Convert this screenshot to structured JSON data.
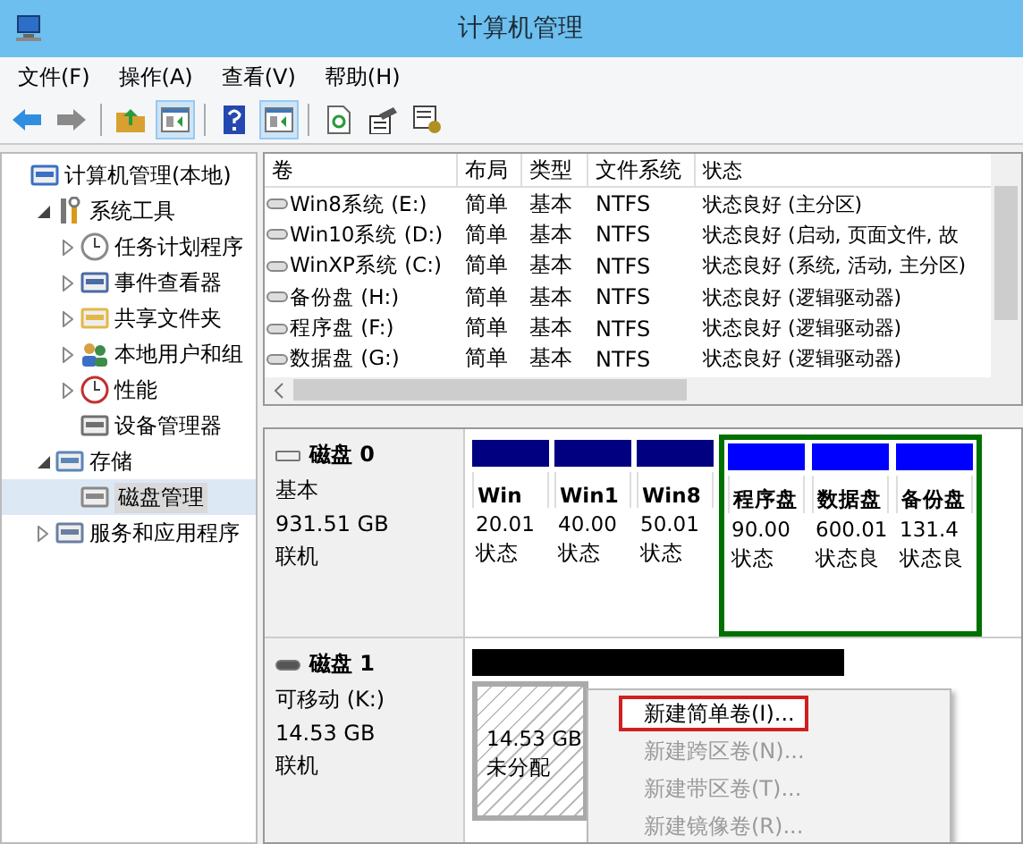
{
  "window": {
    "title": "计算机管理"
  },
  "menu": [
    "文件(F)",
    "操作(A)",
    "查看(V)",
    "帮助(H)"
  ],
  "toolbar": [
    {
      "kind": "back",
      "selected": false
    },
    {
      "kind": "forward",
      "selected": false
    },
    {
      "kind": "sep"
    },
    {
      "kind": "up",
      "selected": false
    },
    {
      "kind": "pane",
      "selected": true
    },
    {
      "kind": "sep"
    },
    {
      "kind": "help",
      "selected": false
    },
    {
      "kind": "pane2",
      "selected": true
    },
    {
      "kind": "sep"
    },
    {
      "kind": "refresh",
      "selected": false
    },
    {
      "kind": "props",
      "selected": false
    },
    {
      "kind": "settings",
      "selected": false
    }
  ],
  "tree": [
    {
      "label": "计算机管理(本地)",
      "kind": "computer",
      "selected": false,
      "children": [
        {
          "label": "系统工具",
          "kind": "tools",
          "expanded": true,
          "selected": false,
          "children": [
            {
              "label": "任务计划程序",
              "kind": "clock",
              "expanded": false,
              "selected": false
            },
            {
              "label": "事件查看器",
              "kind": "log",
              "expanded": false,
              "selected": false
            },
            {
              "label": "共享文件夹",
              "kind": "folder",
              "expanded": false,
              "selected": false
            },
            {
              "label": "本地用户和组",
              "kind": "users",
              "expanded": false,
              "selected": false
            },
            {
              "label": "性能",
              "kind": "perf",
              "expanded": false,
              "selected": false
            },
            {
              "label": "设备管理器",
              "kind": "device",
              "selected": false
            }
          ]
        },
        {
          "label": "存储",
          "kind": "storage",
          "expanded": true,
          "selected": false,
          "children": [
            {
              "label": "磁盘管理",
              "kind": "disk",
              "selected": true
            }
          ]
        },
        {
          "label": "服务和应用程序",
          "kind": "services",
          "expanded": false,
          "selected": false
        }
      ]
    }
  ],
  "table": {
    "columns": [
      "卷",
      "布局",
      "类型",
      "文件系统",
      "状态"
    ],
    "rows": [
      [
        "Win8系统 (E:)",
        "简单",
        "基本",
        "NTFS",
        "状态良好 (主分区)"
      ],
      [
        "Win10系统 (D:)",
        "简单",
        "基本",
        "NTFS",
        "状态良好 (启动, 页面文件, 故"
      ],
      [
        "WinXP系统 (C:)",
        "简单",
        "基本",
        "NTFS",
        "状态良好 (系统, 活动, 主分区)"
      ],
      [
        "备份盘 (H:)",
        "简单",
        "基本",
        "NTFS",
        "状态良好 (逻辑驱动器)"
      ],
      [
        "程序盘 (F:)",
        "简单",
        "基本",
        "NTFS",
        "状态良好 (逻辑驱动器)"
      ],
      [
        "数据盘 (G:)",
        "简单",
        "基本",
        "NTFS",
        "状态良好 (逻辑驱动器)"
      ]
    ]
  },
  "disks": [
    {
      "name": "磁盘 0",
      "type": "基本",
      "size": "931.51 GB",
      "status": "联机",
      "kind": "basic",
      "partitions": [
        {
          "kind": "primary",
          "name": "Win",
          "size": "20.01",
          "status": "状态"
        },
        {
          "kind": "primary",
          "name": "Win1",
          "size": "40.00",
          "status": "状态"
        },
        {
          "kind": "primary",
          "name": "Win8",
          "size": "50.01",
          "status": "状态"
        },
        {
          "kind": "logical",
          "name": "程序盘",
          "size": "90.00",
          "status": "状态"
        },
        {
          "kind": "logical",
          "name": "数据盘",
          "size": "600.01",
          "status": "状态良"
        },
        {
          "kind": "logical",
          "name": "备份盘",
          "size": "131.4",
          "status": "状态良"
        }
      ]
    },
    {
      "name": "磁盘 1",
      "type": "可移动 (K:)",
      "size": "14.53 GB",
      "status": "联机",
      "kind": "removable",
      "partitions": [
        {
          "kind": "unallocated",
          "size": "14.53 GB",
          "status": "未分配"
        }
      ]
    }
  ],
  "context_menu": [
    {
      "label": "新建简单卷(I)...",
      "disabled": false,
      "selected": true
    },
    {
      "label": "新建跨区卷(N)...",
      "disabled": true,
      "selected": false
    },
    {
      "label": "新建带区卷(T)...",
      "disabled": true,
      "selected": false
    },
    {
      "label": "新建镜像卷(R)...",
      "disabled": true,
      "selected": false
    }
  ]
}
